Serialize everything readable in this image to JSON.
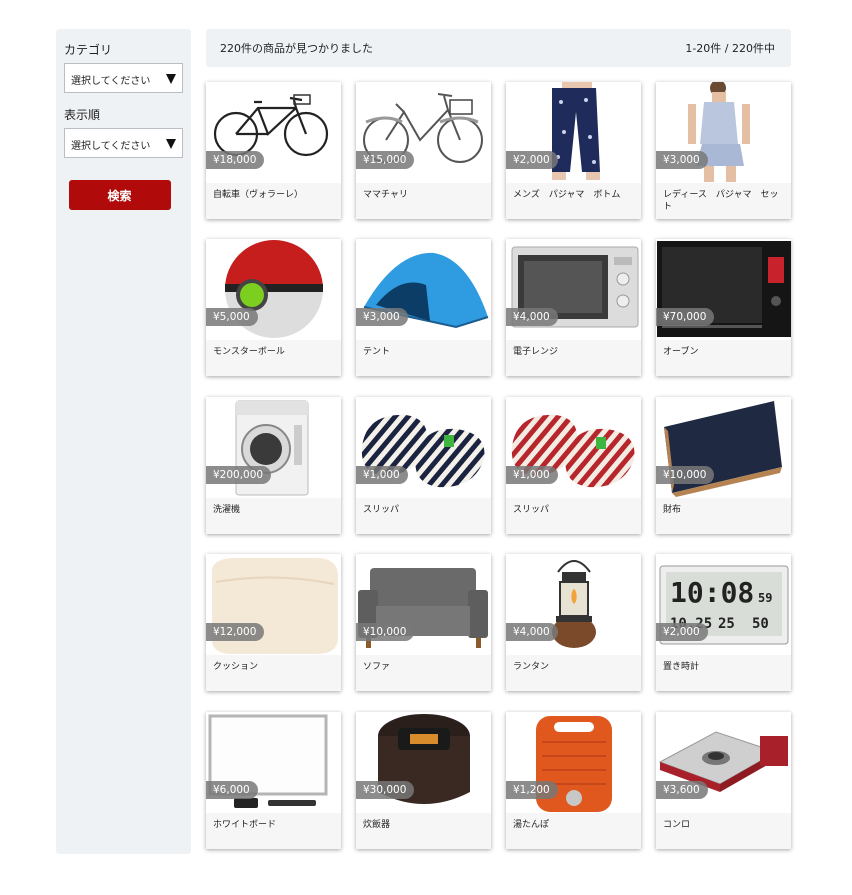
{
  "sidebar": {
    "category_label": "カテゴリ",
    "category_value": "選択してください",
    "sort_label": "表示順",
    "sort_value": "選択してください",
    "search_button": "検索"
  },
  "results": {
    "count_text": "220件の商品が見つかりました",
    "range_text": "1-20件 / 220件中"
  },
  "products": [
    {
      "name": "自転車（ヴォラーレ）",
      "price": "¥18,000",
      "icon": "bicycle-icon"
    },
    {
      "name": "ママチャリ",
      "price": "¥15,000",
      "icon": "city-bicycle-icon"
    },
    {
      "name": "メンズ　パジャマ　ボトム",
      "price": "¥2,000",
      "icon": "pajama-pants-icon"
    },
    {
      "name": "レディース　パジャマ　セット",
      "price": "¥3,000",
      "icon": "pajama-set-icon"
    },
    {
      "name": "モンスターボール",
      "price": "¥5,000",
      "icon": "ball-icon"
    },
    {
      "name": "テント",
      "price": "¥3,000",
      "icon": "tent-icon"
    },
    {
      "name": "電子レンジ",
      "price": "¥4,000",
      "icon": "microwave-icon"
    },
    {
      "name": "オーブン",
      "price": "¥70,000",
      "icon": "oven-icon"
    },
    {
      "name": "洗濯機",
      "price": "¥200,000",
      "icon": "washing-machine-icon"
    },
    {
      "name": "スリッパ",
      "price": "¥1,000",
      "icon": "slippers-navy-icon"
    },
    {
      "name": "スリッパ",
      "price": "¥1,000",
      "icon": "slippers-red-icon"
    },
    {
      "name": "財布",
      "price": "¥10,000",
      "icon": "wallet-icon"
    },
    {
      "name": "クッション",
      "price": "¥12,000",
      "icon": "cushion-icon"
    },
    {
      "name": "ソファ",
      "price": "¥10,000",
      "icon": "sofa-icon"
    },
    {
      "name": "ランタン",
      "price": "¥4,000",
      "icon": "lantern-icon"
    },
    {
      "name": "置き時計",
      "price": "¥2,000",
      "icon": "clock-icon"
    },
    {
      "name": "ホワイトボード",
      "price": "¥6,000",
      "icon": "whiteboard-icon"
    },
    {
      "name": "炊飯器",
      "price": "¥30,000",
      "icon": "rice-cooker-icon"
    },
    {
      "name": "湯たんぽ",
      "price": "¥1,200",
      "icon": "hot-water-bottle-icon"
    },
    {
      "name": "コンロ",
      "price": "¥3,600",
      "icon": "gas-stove-icon"
    }
  ],
  "clock_display": {
    "time": "10:08",
    "seconds": "59",
    "date": "10.25",
    "temp": "25",
    "humidity": "50"
  },
  "colors": {
    "accent": "#b00a0a",
    "panel": "#eff2f5",
    "price_badge": "#787878"
  }
}
